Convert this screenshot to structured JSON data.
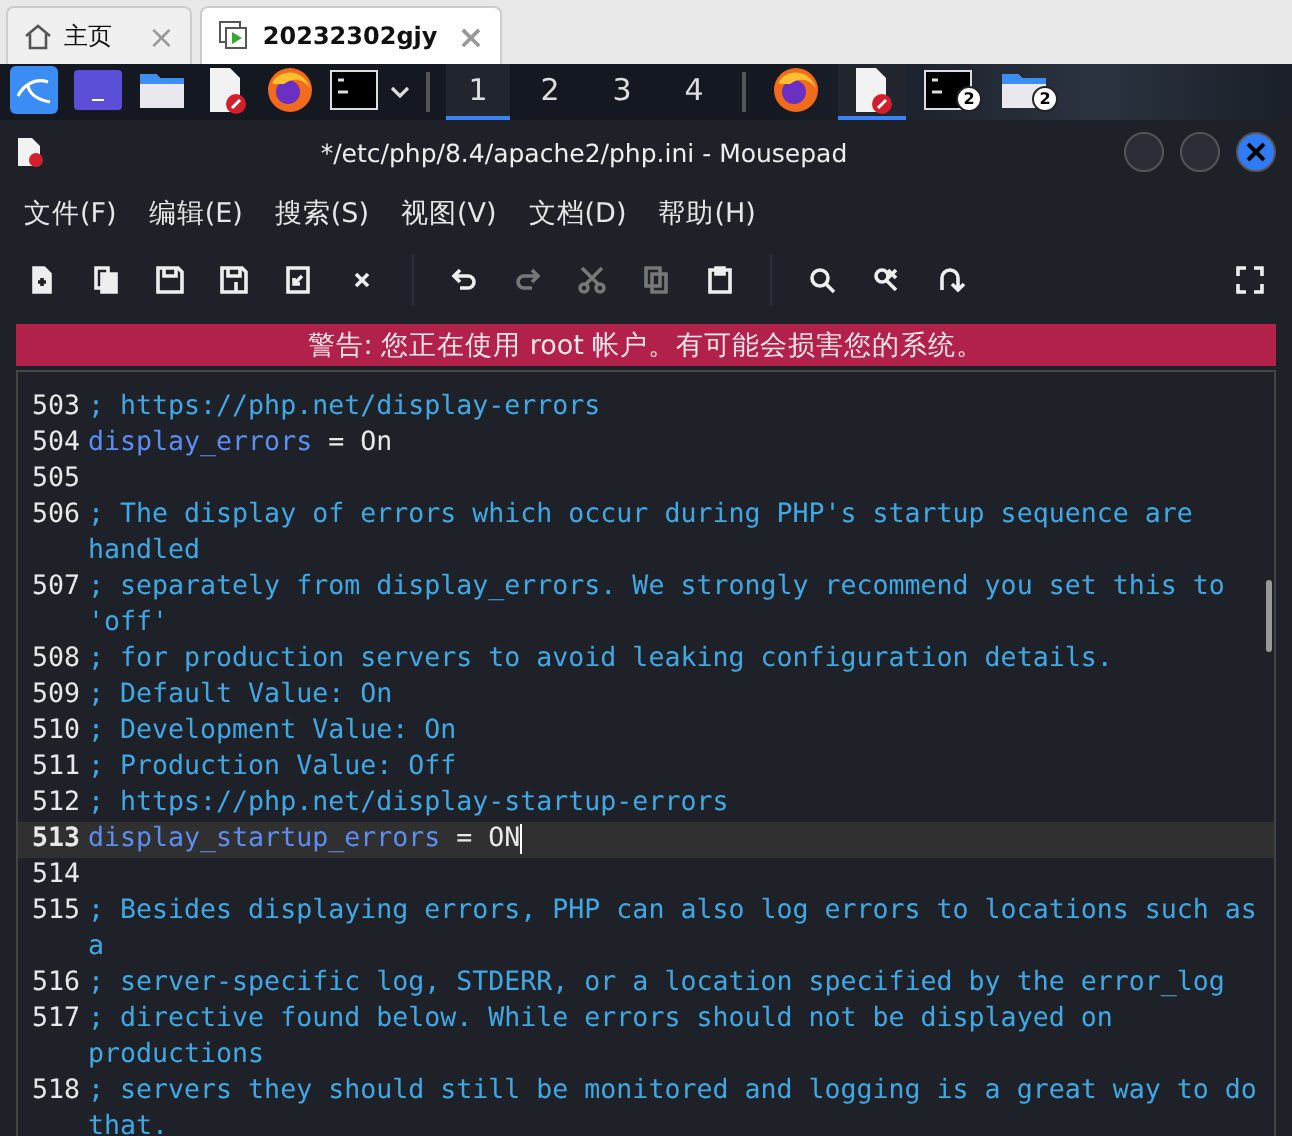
{
  "browser_tabs": [
    {
      "label": "主页",
      "selected": false,
      "close": "×"
    },
    {
      "label": "20232302gjy",
      "selected": true,
      "close": "×"
    }
  ],
  "taskbar": {
    "workspaces": [
      {
        "label": "1",
        "selected": true
      },
      {
        "label": "2",
        "selected": false
      },
      {
        "label": "3",
        "selected": false
      },
      {
        "label": "4",
        "selected": false
      }
    ],
    "windows": [
      {
        "active": false
      },
      {
        "active": true
      },
      {
        "active": false,
        "count": "2"
      },
      {
        "active": false,
        "count": "2"
      }
    ]
  },
  "window": {
    "title": "*/etc/php/8.4/apache2/php.ini - Mousepad"
  },
  "menu": [
    "文件(F)",
    "编辑(E)",
    "搜索(S)",
    "视图(V)",
    "文档(D)",
    "帮助(H)"
  ],
  "toolbar": [
    {
      "disabled": false
    },
    {
      "disabled": false
    },
    {
      "disabled": false
    },
    {
      "disabled": false
    },
    {
      "disabled": false
    },
    {
      "disabled": false
    },
    {
      "disabled": false
    },
    {
      "disabled": true
    },
    {
      "disabled": true
    },
    {
      "disabled": true
    },
    {
      "disabled": false
    },
    {
      "disabled": false
    },
    {
      "disabled": false
    },
    {
      "disabled": false
    },
    {
      "disabled": false
    }
  ],
  "warning": "警告: 您正在使用 root 帐户。有可能会损害您的系统。",
  "editor": {
    "lines": [
      {
        "number": "503",
        "kind": "comment",
        "text": "; https://php.net/display-errors",
        "current": false
      },
      {
        "number": "504",
        "kind": "setting",
        "key": "display_errors",
        "op": " = ",
        "value": "On",
        "current": false
      },
      {
        "number": "505",
        "kind": "blank",
        "current": false
      },
      {
        "number": "506",
        "kind": "comment",
        "text": "; The display of errors which occur during PHP's startup sequence are handled",
        "current": false
      },
      {
        "number": "507",
        "kind": "comment",
        "text": "; separately from display_errors. We strongly recommend you set this to 'off'",
        "current": false
      },
      {
        "number": "508",
        "kind": "comment",
        "text": "; for production servers to avoid leaking configuration details.",
        "current": false
      },
      {
        "number": "509",
        "kind": "comment",
        "text": "; Default Value: On",
        "current": false
      },
      {
        "number": "510",
        "kind": "comment",
        "text": "; Development Value: On",
        "current": false
      },
      {
        "number": "511",
        "kind": "comment",
        "text": "; Production Value: Off",
        "current": false
      },
      {
        "number": "512",
        "kind": "comment",
        "text": "; https://php.net/display-startup-errors",
        "current": false
      },
      {
        "number": "513",
        "kind": "setting",
        "key": "display_startup_errors",
        "op": " = ",
        "value": "ON",
        "current": true
      },
      {
        "number": "514",
        "kind": "blank",
        "current": false
      },
      {
        "number": "515",
        "kind": "comment",
        "text": "; Besides displaying errors, PHP can also log errors to locations such as a",
        "current": false
      },
      {
        "number": "516",
        "kind": "comment",
        "text": "; server-specific log, STDERR, or a location specified by the error_log",
        "current": false
      },
      {
        "number": "517",
        "kind": "comment",
        "text": "; directive found below. While errors should not be displayed on productions",
        "current": false
      },
      {
        "number": "518",
        "kind": "comment",
        "text": "; servers they should still be monitored and logging is a great way to do that.",
        "current": false
      }
    ]
  }
}
